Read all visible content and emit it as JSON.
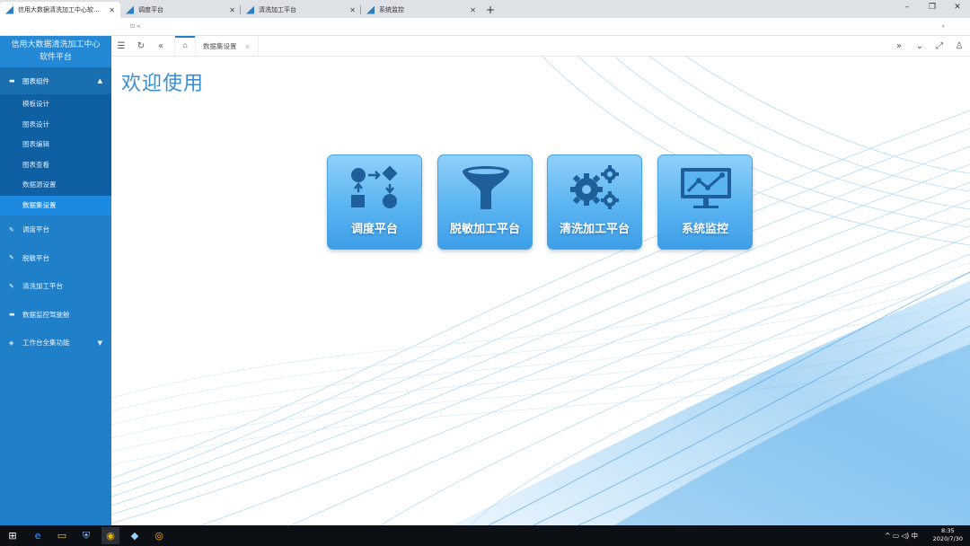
{
  "browser": {
    "tabs": [
      {
        "title": "信用大数据清洗加工中心软件平台",
        "active": true
      },
      {
        "title": "调度平台",
        "active": false
      },
      {
        "title": "清洗加工平台",
        "active": false
      },
      {
        "title": "系统监控",
        "active": false
      }
    ],
    "new_tab": "+",
    "window_controls": [
      "–",
      "❐",
      "✕"
    ],
    "address": "⊡ < ",
    "address_right": "»"
  },
  "sidebar": {
    "brand_line1": "信用大数据清洗加工中心",
    "brand_line2": "软件平台",
    "group": {
      "label": "图表组件",
      "caret": "▲"
    },
    "sub_items": [
      "模板设计",
      "图表设计",
      "图表编辑",
      "图表查看",
      "数据源设置",
      "数据集设置"
    ],
    "selected_sub": "数据集设置",
    "items": [
      {
        "label": "调度平台"
      },
      {
        "label": "脱敏平台"
      },
      {
        "label": "清洗加工平台"
      },
      {
        "label": "数据监控驾驶舱"
      },
      {
        "label": "工作台全集功能",
        "caret": "▼"
      }
    ]
  },
  "toolbar": {
    "page_tab": "数据集设置",
    "page_tab_close": "×"
  },
  "main": {
    "welcome": "欢迎使用",
    "tiles": [
      {
        "label": "调度平台",
        "icon": "flowchart-icon"
      },
      {
        "label": "脱敏加工平台",
        "icon": "funnel-icon"
      },
      {
        "label": "清洗加工平台",
        "icon": "gears-icon"
      },
      {
        "label": "系统监控",
        "icon": "monitor-chart-icon"
      }
    ]
  },
  "taskbar": {
    "tray_lang": "中",
    "time": "8:35",
    "date": "2020/7/30"
  },
  "colors": {
    "sidebar": "#1f7fc8",
    "sidebar_selected": "#1c8ae0",
    "tile": "#5ab4f0",
    "welcome": "#3a8dd0"
  }
}
